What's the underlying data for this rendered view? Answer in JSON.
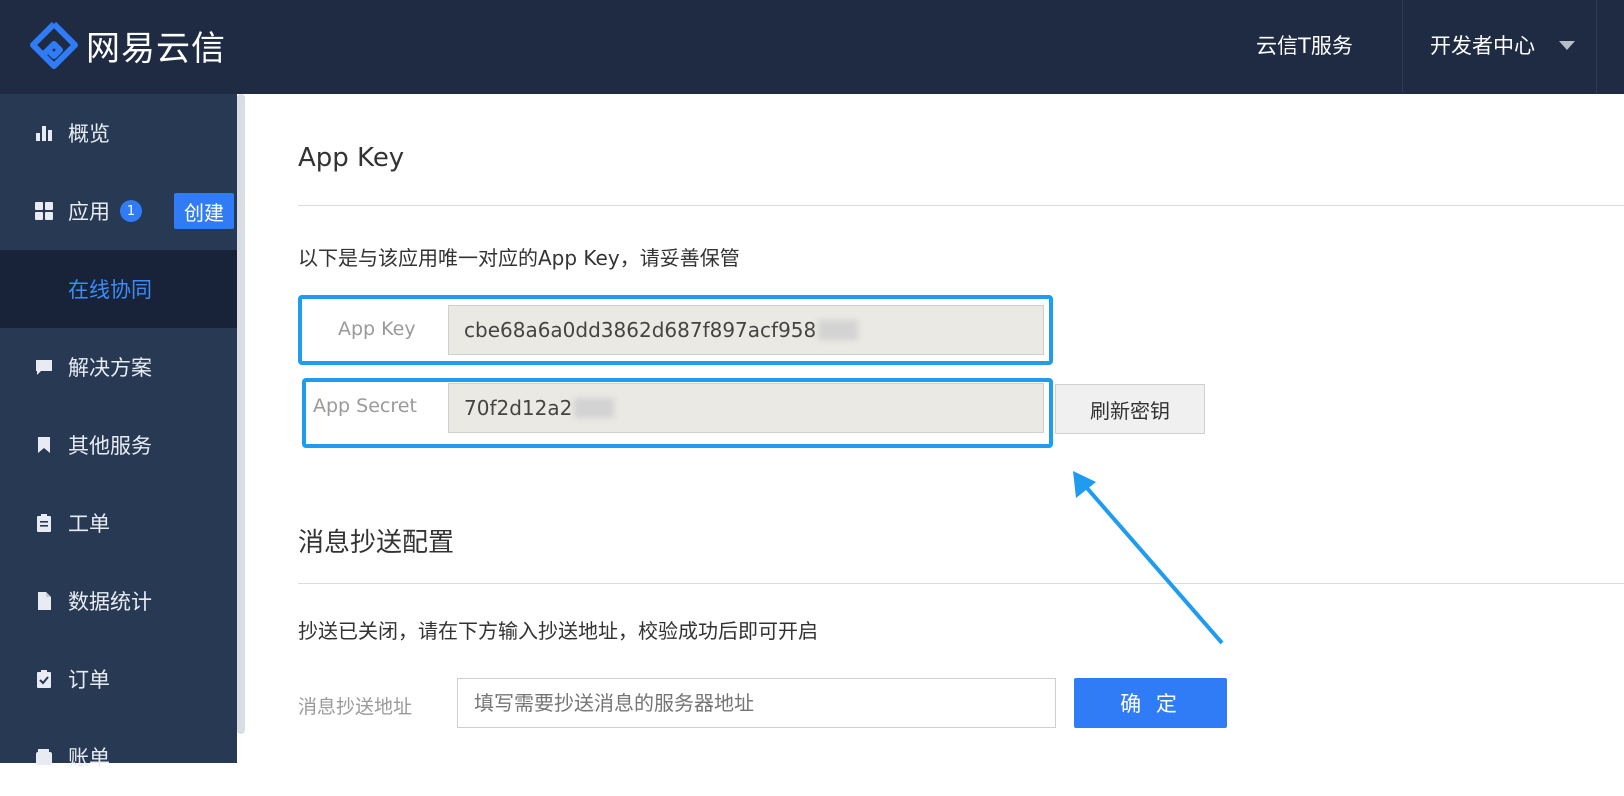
{
  "header": {
    "logo_text": "网易云信",
    "nav_service": "云信T服务",
    "nav_dev": "开发者中心"
  },
  "sidebar": {
    "items": [
      {
        "label": "概览",
        "icon": "bar-chart-icon"
      },
      {
        "label": "应用",
        "icon": "grid-icon",
        "badge": "1",
        "action": "创建"
      },
      {
        "label": "在线协同",
        "sub": true
      },
      {
        "label": "解决方案",
        "icon": "chat-icon"
      },
      {
        "label": "其他服务",
        "icon": "bookmark-icon"
      },
      {
        "label": "工单",
        "icon": "clipboard-icon"
      },
      {
        "label": "数据统计",
        "icon": "document-icon"
      },
      {
        "label": "订单",
        "icon": "clipboard-check-icon"
      },
      {
        "label": "账单",
        "icon": "wallet-icon"
      }
    ]
  },
  "main": {
    "appkey_section": {
      "title": "App Key",
      "desc": "以下是与该应用唯一对应的App Key，请妥善保管",
      "appkey_label": "App Key",
      "appkey_value": "cbe68a6a0dd3862d687f897acf958",
      "secret_label": "App Secret",
      "secret_value": "70f2d12a2",
      "refresh_label": "刷新密钥"
    },
    "cc_section": {
      "title": "消息抄送配置",
      "desc": "抄送已关闭，请在下方输入抄送地址，校验成功后即可开启",
      "addr_label": "消息抄送地址",
      "addr_placeholder": "填写需要抄送消息的服务器地址",
      "confirm_label": "确 定"
    }
  },
  "colors": {
    "header_bg": "#1f2b43",
    "sidebar_bg": "#283954",
    "accent": "#2f7cf6",
    "highlight": "#1f9bef"
  }
}
